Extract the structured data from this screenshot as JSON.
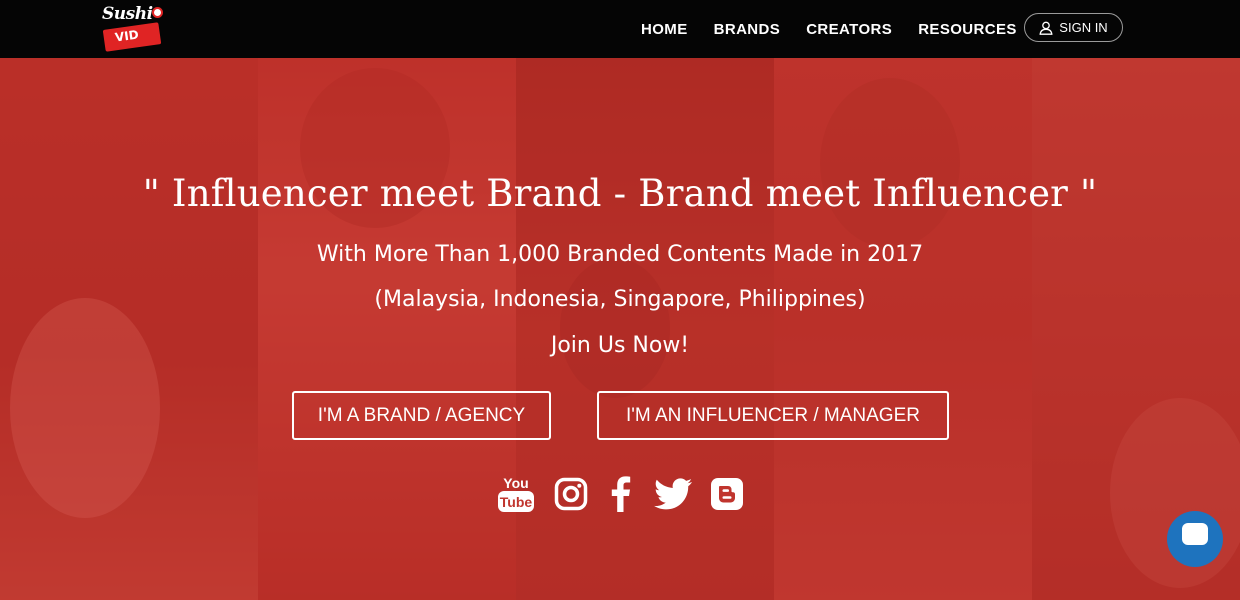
{
  "brand": {
    "logo_top": "Sushi",
    "logo_bottom": "VID"
  },
  "nav": {
    "items": [
      {
        "label": "HOME"
      },
      {
        "label": "BRANDS"
      },
      {
        "label": "CREATORS"
      },
      {
        "label": "RESOURCES"
      }
    ],
    "signin_label": "SIGN IN"
  },
  "hero": {
    "title": "\" Influencer meet Brand - Brand meet Influencer \"",
    "line1": "With More Than 1,000 Branded Contents Made in 2017",
    "line2": "(Malaysia, Indonesia, Singapore, Philippines)",
    "line3": "Join Us Now!",
    "cta_brand": "I'M A BRAND / AGENCY",
    "cta_influencer": "I'M AN INFLUENCER / MANAGER"
  },
  "social": [
    {
      "icon": "youtube-icon",
      "top": "You",
      "bottom": "Tube"
    },
    {
      "icon": "instagram-icon"
    },
    {
      "icon": "facebook-icon"
    },
    {
      "icon": "twitter-icon"
    },
    {
      "icon": "blogger-icon"
    }
  ],
  "colors": {
    "navbar": "#050505",
    "overlay": "#c82d26",
    "accent": "#e02424",
    "chat": "#1e73be"
  }
}
